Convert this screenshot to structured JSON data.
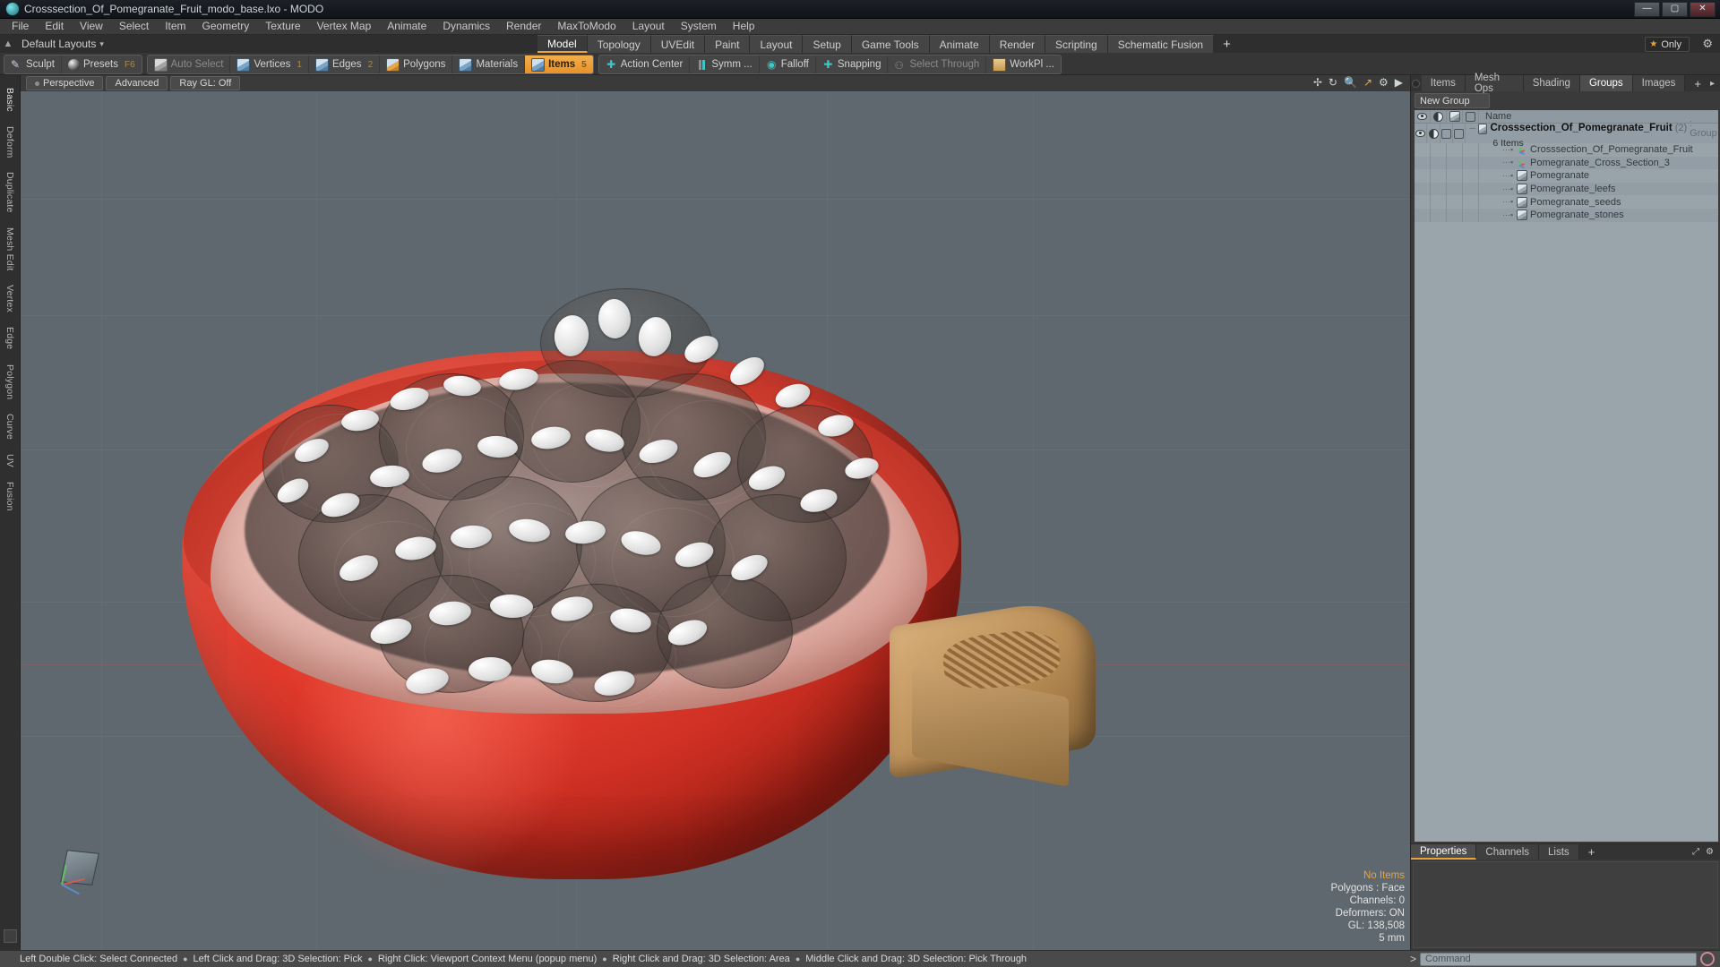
{
  "window": {
    "title": "Crosssection_Of_Pomegranate_Fruit_modo_base.lxo - MODO",
    "logo_icon": "modo-logo-icon",
    "minimize_label": "—",
    "maximize_label": "▢",
    "close_label": "✕"
  },
  "menubar": {
    "items": [
      "File",
      "Edit",
      "View",
      "Select",
      "Item",
      "Geometry",
      "Texture",
      "Vertex Map",
      "Animate",
      "Dynamics",
      "Render",
      "MaxToModo",
      "Layout",
      "System",
      "Help"
    ]
  },
  "layoutbar": {
    "home_icon": "home-icon",
    "layout_label": "Default Layouts",
    "caret": "▾",
    "tabs": [
      {
        "label": "Model",
        "active": true
      },
      {
        "label": "Topology",
        "active": false
      },
      {
        "label": "UVEdit",
        "active": false
      },
      {
        "label": "Paint",
        "active": false
      },
      {
        "label": "Layout",
        "active": false
      },
      {
        "label": "Setup",
        "active": false
      },
      {
        "label": "Game Tools",
        "active": false
      },
      {
        "label": "Animate",
        "active": false
      },
      {
        "label": "Render",
        "active": false
      },
      {
        "label": "Scripting",
        "active": false
      },
      {
        "label": "Schematic Fusion",
        "active": false
      }
    ],
    "add_tab_label": "+",
    "only_label": "Only",
    "star_icon": "star-icon",
    "gear_icon": "gear-icon"
  },
  "toolbar": {
    "group1": [
      {
        "label": "Sculpt",
        "icon": "pen-icon",
        "key": "",
        "state": "normal"
      },
      {
        "label": "Presets",
        "icon": "sphere-icon",
        "key": "F6",
        "state": "normal"
      }
    ],
    "group2": [
      {
        "label": "Auto Select",
        "icon": "cube-gray-icon",
        "key": "",
        "state": "dim"
      },
      {
        "label": "Vertices",
        "icon": "cube-icon",
        "key": "1",
        "state": "normal"
      },
      {
        "label": "Edges",
        "icon": "cube-icon",
        "key": "2",
        "state": "normal"
      },
      {
        "label": "Polygons",
        "icon": "cube-orange-icon",
        "key": "",
        "state": "normal"
      },
      {
        "label": "Materials",
        "icon": "cube-icon",
        "key": "",
        "state": "normal"
      },
      {
        "label": "Items",
        "icon": "cube-icon",
        "key": "5",
        "state": "active"
      }
    ],
    "group3": [
      {
        "label": "Action Center",
        "icon": "crosshair-icon",
        "key": "",
        "state": "normal"
      },
      {
        "label": "Symm ...",
        "icon": "symmetry-icon",
        "key": "",
        "state": "normal"
      },
      {
        "label": "Falloff",
        "icon": "falloff-icon",
        "key": "",
        "state": "normal"
      },
      {
        "label": "Snapping",
        "icon": "snapping-icon",
        "key": "",
        "state": "normal"
      },
      {
        "label": "Select Through",
        "icon": "select-through-icon",
        "key": "",
        "state": "dim"
      },
      {
        "label": "WorkPl ...",
        "icon": "workplane-icon",
        "key": "",
        "state": "normal"
      }
    ]
  },
  "left_tabs": {
    "items": [
      "Basic",
      "Deform",
      "Duplicate",
      "Mesh Edit",
      "Vertex",
      "Edge",
      "Polygon",
      "Curve",
      "UV",
      "Fusion"
    ]
  },
  "viewport": {
    "buttons": [
      {
        "label": "Perspective",
        "dot": true
      },
      {
        "label": "Advanced",
        "dot": false
      },
      {
        "label": "Ray GL: Off",
        "dot": false
      }
    ],
    "icons": [
      "move-icon",
      "rotate-icon",
      "zoom-icon",
      "fit-icon",
      "gear-icon",
      "arrow-right-icon"
    ],
    "stats": {
      "items_label": "No Items",
      "polygons": "Polygons : Face",
      "channels": "Channels: 0",
      "deformers": "Deformers: ON",
      "gl": "GL: 138,508",
      "scale": "5 mm"
    },
    "gizmo_icon": "axis-gizmo-icon"
  },
  "right_panel": {
    "tabs": [
      {
        "label": "Items",
        "active": false
      },
      {
        "label": "Mesh Ops",
        "active": false
      },
      {
        "label": "Shading",
        "active": false
      },
      {
        "label": "Groups",
        "active": true
      },
      {
        "label": "Images",
        "active": false
      }
    ],
    "add_tab_label": "+",
    "arrow_label": "▸",
    "new_group_label": "New Group",
    "tree_headers": {
      "visible_icon": "eye-icon",
      "shade_icon": "half-circle-icon",
      "render_icon": "cube-icon",
      "wire_icon": "outline-cube-icon",
      "name": "Name"
    },
    "group_row": {
      "name": "Crosssection_Of_Pomegranate_Fruit",
      "count": "(2)",
      "type": ": Group",
      "sub": "6 Items"
    },
    "items": [
      {
        "name": "Crosssection_Of_Pomegranate_Fruit",
        "icon": "axis-locator-icon"
      },
      {
        "name": "Pomegranate_Cross_Section_3",
        "icon": "axis-locator-icon"
      },
      {
        "name": "Pomegranate",
        "icon": "mesh-cube-icon"
      },
      {
        "name": "Pomegranate_leefs",
        "icon": "mesh-cube-icon"
      },
      {
        "name": "Pomegranate_seeds",
        "icon": "mesh-cube-icon"
      },
      {
        "name": "Pomegranate_stones",
        "icon": "mesh-cube-icon"
      }
    ]
  },
  "properties_panel": {
    "tabs": [
      {
        "label": "Properties",
        "active": true
      },
      {
        "label": "Channels",
        "active": false
      },
      {
        "label": "Lists",
        "active": false
      }
    ],
    "add_tab_label": "+",
    "maximize_icon": "maximize-icon",
    "gear_icon": "gear-icon"
  },
  "statusbar": {
    "hints": [
      "Left Double Click: Select Connected",
      "Left Click and Drag: 3D Selection: Pick",
      "Right Click: Viewport Context Menu (popup menu)",
      "Right Click and Drag: 3D Selection: Area",
      "Middle Click and Drag: 3D Selection: Pick Through"
    ],
    "command_prompt": ">",
    "command_placeholder": "Command",
    "record_icon": "record-icon"
  }
}
